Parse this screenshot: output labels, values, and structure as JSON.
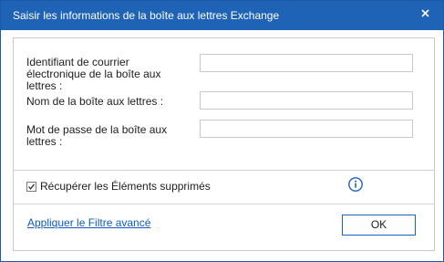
{
  "window": {
    "title": "Saisir les informations de la boîte aux lettres Exchange",
    "close_icon": "close-icon",
    "accent_color": "#1f63b6"
  },
  "form": {
    "email_label": "Identifiant de courrier électronique de la boîte aux lettres :",
    "email_value": "",
    "mailbox_label": "Nom de la boîte aux lettres :",
    "mailbox_value": "",
    "password_label": "Mot de passe de la boîte aux lettres :",
    "password_value": ""
  },
  "options": {
    "recover_deleted_label": "Récupérer les Éléments supprimés",
    "recover_deleted_checked": true,
    "info_icon": "info-icon"
  },
  "footer": {
    "advanced_filter_link": "Appliquer le Filtre avancé",
    "ok_label": "OK"
  }
}
